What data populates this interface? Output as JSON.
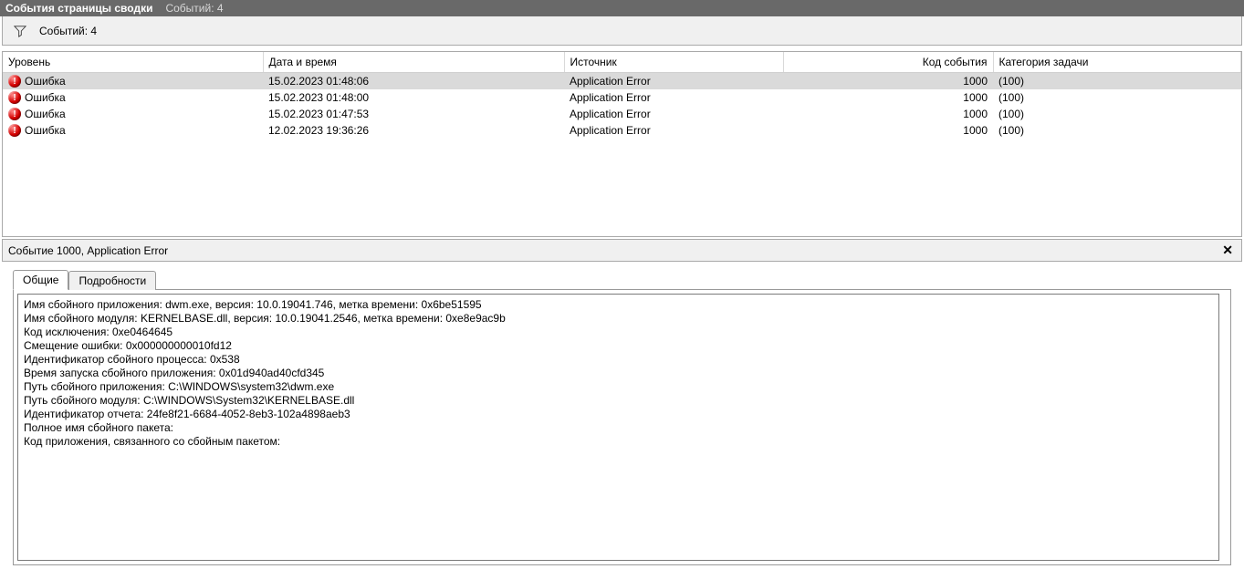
{
  "titlebar": {
    "title": "События страницы сводки",
    "count_label": "Событий: 4"
  },
  "filterbar": {
    "count_label": "Событий: 4"
  },
  "columns": {
    "level": "Уровень",
    "datetime": "Дата и время",
    "source": "Источник",
    "event_id": "Код события",
    "task_cat": "Категория задачи"
  },
  "rows": [
    {
      "level": "Ошибка",
      "datetime": "15.02.2023 01:48:06",
      "source": "Application Error",
      "event_id": "1000",
      "task_cat": "(100)",
      "selected": true
    },
    {
      "level": "Ошибка",
      "datetime": "15.02.2023 01:48:00",
      "source": "Application Error",
      "event_id": "1000",
      "task_cat": "(100)",
      "selected": false
    },
    {
      "level": "Ошибка",
      "datetime": "15.02.2023 01:47:53",
      "source": "Application Error",
      "event_id": "1000",
      "task_cat": "(100)",
      "selected": false
    },
    {
      "level": "Ошибка",
      "datetime": "12.02.2023 19:36:26",
      "source": "Application Error",
      "event_id": "1000",
      "task_cat": "(100)",
      "selected": false
    }
  ],
  "detail": {
    "header": "Событие 1000, Application Error",
    "tabs": {
      "general": "Общие",
      "details": "Подробности"
    },
    "lines": [
      "Имя сбойного приложения: dwm.exe, версия: 10.0.19041.746, метка времени: 0x6be51595",
      "Имя сбойного модуля: KERNELBASE.dll, версия: 10.0.19041.2546, метка времени: 0xe8e9ac9b",
      "Код исключения: 0xe0464645",
      "Смещение ошибки: 0x000000000010fd12",
      "Идентификатор сбойного процесса: 0x538",
      "Время запуска сбойного приложения: 0x01d940ad40cfd345",
      "Путь сбойного приложения: C:\\WINDOWS\\system32\\dwm.exe",
      "Путь сбойного модуля: C:\\WINDOWS\\System32\\KERNELBASE.dll",
      "Идентификатор отчета: 24fe8f21-6684-4052-8eb3-102a4898aeb3",
      "Полное имя сбойного пакета:",
      "Код приложения, связанного со сбойным пакетом:"
    ]
  }
}
